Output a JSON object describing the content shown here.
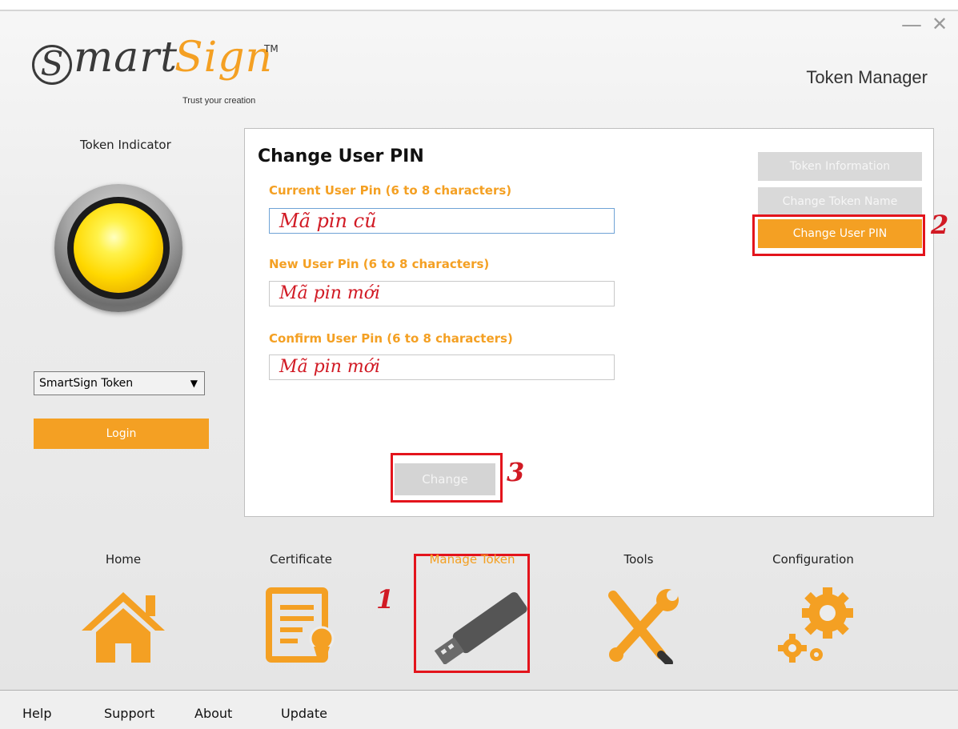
{
  "window": {
    "minimize_glyph": "—",
    "close_glyph": "✕",
    "title": "Token Manager"
  },
  "logo": {
    "s_letter": "S",
    "mart": "mart",
    "sign": "Sign",
    "tm": "TM",
    "tagline": "Trust your creation"
  },
  "sidebar": {
    "indicator_label": "Token Indicator",
    "token_select_value": "SmartSign Token",
    "login_label": "Login"
  },
  "panel": {
    "title": "Change User PIN",
    "fields": [
      {
        "label": "Current User Pin (6 to 8 characters)",
        "value": "Mã pin cũ"
      },
      {
        "label": "New User Pin (6 to 8 characters)",
        "value": "Mã pin mới"
      },
      {
        "label": "Confirm User Pin (6 to 8 characters)",
        "value": "Mã pin mới"
      }
    ],
    "side_buttons": [
      {
        "label": "Token Information",
        "active": false
      },
      {
        "label": "Change Token Name",
        "active": false
      },
      {
        "label": "Change User PIN",
        "active": true
      }
    ],
    "change_label": "Change"
  },
  "annotations": {
    "step1": "1",
    "step2": "2",
    "step3": "3"
  },
  "nav": [
    {
      "label": "Home",
      "icon": "home-icon",
      "active": false
    },
    {
      "label": "Certificate",
      "icon": "certificate-icon",
      "active": false
    },
    {
      "label": "Manage Token",
      "icon": "usb-token-icon",
      "active": true
    },
    {
      "label": "Tools",
      "icon": "tools-icon",
      "active": false
    },
    {
      "label": "Configuration",
      "icon": "gears-icon",
      "active": false
    }
  ],
  "bottom_links": [
    "Help",
    "Support",
    "About",
    "Update"
  ],
  "colors": {
    "accent": "#f4a023",
    "annotation_red": "#e3141c",
    "disabled_button": "#d9d9d9"
  }
}
